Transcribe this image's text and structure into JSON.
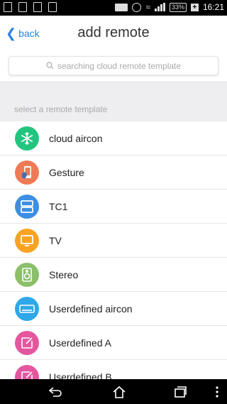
{
  "status_bar": {
    "battery": "33%",
    "time": "16:21"
  },
  "header": {
    "back_label": "back",
    "title": "add remote"
  },
  "search": {
    "placeholder": "searching cloud remote template"
  },
  "section_label": "select a remote template",
  "templates": [
    {
      "label": "cloud aircon",
      "color": "#22c57f",
      "icon": "snowflake-icon"
    },
    {
      "label": "Gesture",
      "color": "#ef7a56",
      "icon": "hand-phone-icon"
    },
    {
      "label": "TC1",
      "color": "#3b8fe4",
      "icon": "panels-icon"
    },
    {
      "label": "TV",
      "color": "#f8a321",
      "icon": "tv-icon"
    },
    {
      "label": "Stereo",
      "color": "#8bbf6a",
      "icon": "speaker-icon"
    },
    {
      "label": "Userdefined aircon",
      "color": "#2ea8e8",
      "icon": "aircon-icon"
    },
    {
      "label": "Userdefined A",
      "color": "#e6569f",
      "icon": "edit-icon"
    },
    {
      "label": "Userdefined B",
      "color": "#e6569f",
      "icon": "edit-icon"
    }
  ]
}
